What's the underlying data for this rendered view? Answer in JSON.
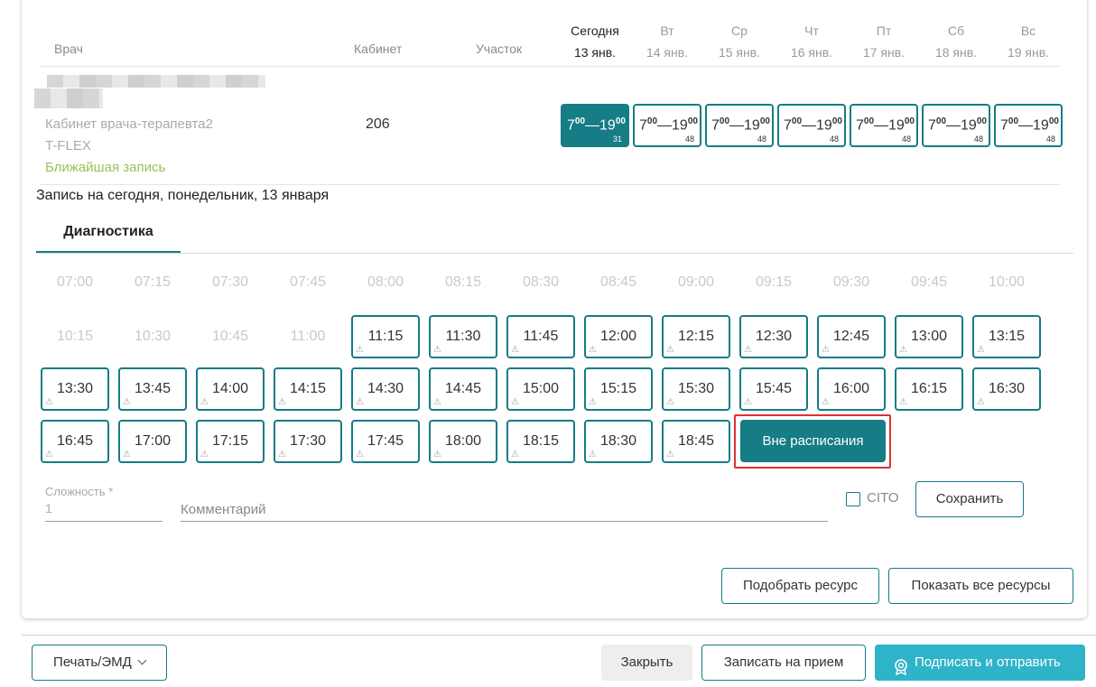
{
  "header": {
    "doctor_col": "Врач",
    "cabinet_col": "Кабинет",
    "area_col": "Участок",
    "days": [
      {
        "name": "Сегодня",
        "date": "13 янв."
      },
      {
        "name": "Вт",
        "date": "14 янв."
      },
      {
        "name": "Ср",
        "date": "15 янв."
      },
      {
        "name": "Чт",
        "date": "16 янв."
      },
      {
        "name": "Пт",
        "date": "17 янв."
      },
      {
        "name": "Сб",
        "date": "18 янв."
      },
      {
        "name": "Вс",
        "date": "19 янв."
      }
    ]
  },
  "doctor": {
    "cabinet_name": "Кабинет врача-терапевта2",
    "org": "T-FLEX",
    "nearest": "Ближайшая запись",
    "cabinet_number": "206"
  },
  "schedule": [
    {
      "start": "7",
      "start_min": "00",
      "end": "19",
      "end_min": "00",
      "count": "31"
    },
    {
      "start": "7",
      "start_min": "00",
      "end": "19",
      "end_min": "00",
      "count": "48"
    },
    {
      "start": "7",
      "start_min": "00",
      "end": "19",
      "end_min": "00",
      "count": "48"
    },
    {
      "start": "7",
      "start_min": "00",
      "end": "19",
      "end_min": "00",
      "count": "48"
    },
    {
      "start": "7",
      "start_min": "00",
      "end": "19",
      "end_min": "00",
      "count": "48"
    },
    {
      "start": "7",
      "start_min": "00",
      "end": "19",
      "end_min": "00",
      "count": "48"
    },
    {
      "start": "7",
      "start_min": "00",
      "end": "19",
      "end_min": "00",
      "count": "48"
    }
  ],
  "today_title": "Запись на сегодня, понедельник, 13 января",
  "tab_label": "Диагностика",
  "slots_disabled": [
    "07:00",
    "07:15",
    "07:30",
    "07:45",
    "08:00",
    "08:15",
    "08:30",
    "08:45",
    "09:00",
    "09:15",
    "09:30",
    "09:45",
    "10:00",
    "10:15",
    "10:30",
    "10:45",
    "11:00"
  ],
  "slots_available": [
    "11:15",
    "11:30",
    "11:45",
    "12:00",
    "12:15",
    "12:30",
    "12:45",
    "13:00",
    "13:15",
    "13:30",
    "13:45",
    "14:00",
    "14:15",
    "14:30",
    "14:45",
    "15:00",
    "15:15",
    "15:30",
    "15:45",
    "16:00",
    "16:15",
    "16:30",
    "16:45",
    "17:00",
    "17:15",
    "17:30",
    "17:45",
    "18:00",
    "18:15",
    "18:30",
    "18:45"
  ],
  "out_of_schedule": "Вне расписания",
  "form": {
    "complexity_label": "Сложность *",
    "complexity_value": "1",
    "comment_placeholder": "Комментарий",
    "cito_label": "CITO",
    "save": "Сохранить"
  },
  "actions": {
    "pick_resource": "Подобрать ресурс",
    "show_all": "Показать все ресурсы"
  },
  "footer": {
    "print": "Печать/ЭМД",
    "close": "Закрыть",
    "book": "Записать на прием",
    "sign_send": "Подписать и отправить"
  },
  "colors": {
    "accent": "#167c86",
    "primary_button": "#2fb3c8",
    "highlight": "#e03030",
    "nearest_text": "#9bc15a"
  }
}
